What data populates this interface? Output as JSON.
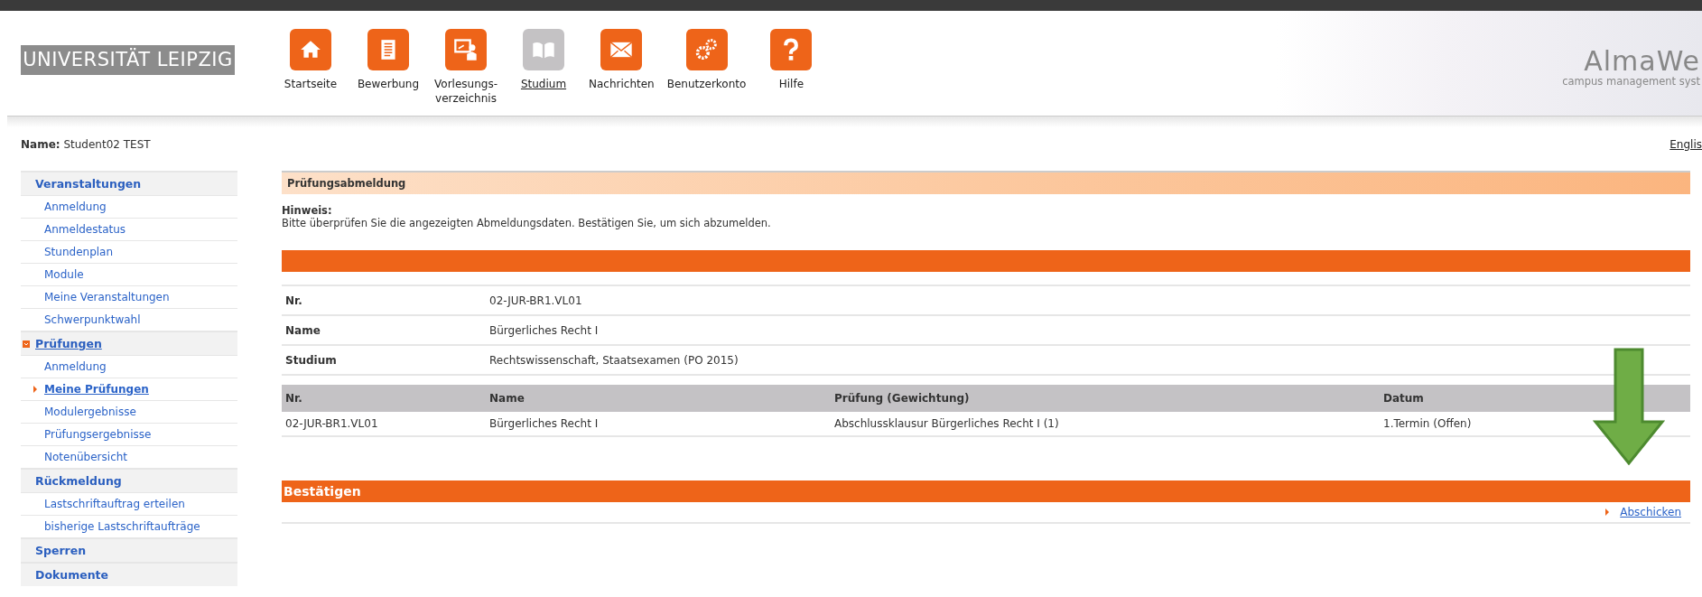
{
  "header": {
    "university": "UNIVERSITÄT LEIPZIG",
    "brand": "AlmaWe",
    "brand_tagline": "campus management syst",
    "nav": [
      {
        "kind": "home",
        "label": "Startseite",
        "selected": false
      },
      {
        "kind": "document",
        "label": "Bewerbung",
        "selected": false
      },
      {
        "kind": "presenter",
        "label": "Vorlesungs-\nverzeichnis",
        "selected": false
      },
      {
        "kind": "book",
        "label": "Studium",
        "selected": true
      },
      {
        "kind": "mail",
        "label": "Nachrichten",
        "selected": false
      },
      {
        "kind": "gears",
        "label": "Benutzerkonto",
        "selected": false
      },
      {
        "kind": "help",
        "label": "Hilfe",
        "selected": false
      }
    ]
  },
  "user": {
    "label": "Name:",
    "value": "Student02 TEST"
  },
  "language_link": "Englis",
  "sidebar": [
    {
      "label": "Veranstaltungen",
      "expanded": false,
      "children": [
        {
          "label": "Anmeldung",
          "selected": false
        },
        {
          "label": "Anmeldestatus",
          "selected": false
        },
        {
          "label": "Stundenplan",
          "selected": false
        },
        {
          "label": "Module",
          "selected": false
        },
        {
          "label": "Meine Veranstaltungen",
          "selected": false
        },
        {
          "label": "Schwerpunktwahl",
          "selected": false
        }
      ]
    },
    {
      "label": "Prüfungen",
      "expanded": true,
      "children": [
        {
          "label": "Anmeldung",
          "selected": false
        },
        {
          "label": "Meine Prüfungen",
          "selected": true
        },
        {
          "label": "Modulergebnisse",
          "selected": false
        },
        {
          "label": "Prüfungsergebnisse",
          "selected": false
        },
        {
          "label": "Notenübersicht",
          "selected": false
        }
      ]
    },
    {
      "label": "Rückmeldung",
      "expanded": false,
      "children": [
        {
          "label": "Lastschriftauftrag erteilen",
          "selected": false
        },
        {
          "label": "bisherige Lastschriftaufträge",
          "selected": false
        }
      ]
    },
    {
      "label": "Sperren",
      "expanded": false
    },
    {
      "label": "Dokumente",
      "expanded": false
    }
  ],
  "main": {
    "title": "Prüfungsabmeldung",
    "notice_label": "Hinweis:",
    "notice": "Bitte überprüfen Sie die angezeigten Abmeldungsdaten. Bestätigen Sie, um sich abzumelden.",
    "details": [
      {
        "label": "Nr.",
        "value": "02-JUR-BR1.VL01"
      },
      {
        "label": "Name",
        "value": "Bürgerliches Recht I"
      },
      {
        "label": "Studium",
        "value": "Rechtswissenschaft, Staatsexamen (PO 2015)"
      }
    ],
    "table": {
      "columns": [
        "Nr.",
        "Name",
        "Prüfung  (Gewichtung)",
        "Datum"
      ],
      "rows": [
        [
          "02-JUR-BR1.VL01",
          "Bürgerliches Recht I",
          "Abschlussklausur Bürgerliches Recht I (1)",
          "1.Termin (Offen)"
        ]
      ]
    },
    "confirm_title": "Bestätigen",
    "submit_link": "Abschicken"
  }
}
